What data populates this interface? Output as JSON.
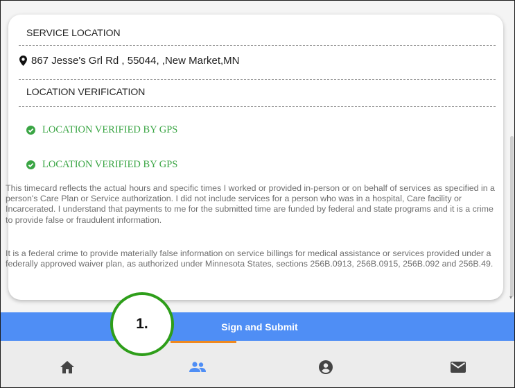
{
  "card": {
    "service_location_heading": "SERVICE LOCATION",
    "address": "867 Jesse's Grl Rd , 55044, ,New Market,MN",
    "location_verification_heading": "LOCATION VERIFICATION",
    "verifications": [
      "LOCATION VERIFIED BY GPS",
      "LOCATION VERIFIED BY GPS"
    ],
    "attestation_1": "This timecard reflects the actual hours and specific times I worked or provided in-person or on behalf of services as specified in a person's Care Plan or Service authorization. I did not include services for a person who was in a hospital, Care facility or Incarcerated. I understand that payments to me for the submitted time are funded by federal and state programs and it is a crime to provide false or fraudulent information.",
    "attestation_2": "It is a federal crime to provide materially false information on service billings for medical assistance or services provided under a federally approved waiver plan, as authorized under Minnesota States, sections 256B.0913, 256B.0915, 256B.092 and 256B.49."
  },
  "submit": {
    "label": "Sign and Submit"
  },
  "annotation": {
    "label": "1."
  },
  "nav": {
    "items": [
      "home-icon",
      "users-icon",
      "account-circle-icon",
      "mail-icon"
    ],
    "active": "users-icon"
  },
  "colors": {
    "accent_blue": "#4f8ef5",
    "verified_green": "#3aa544",
    "nav_indicator": "#f0891e",
    "annotation_ring": "#2e9e1a"
  }
}
